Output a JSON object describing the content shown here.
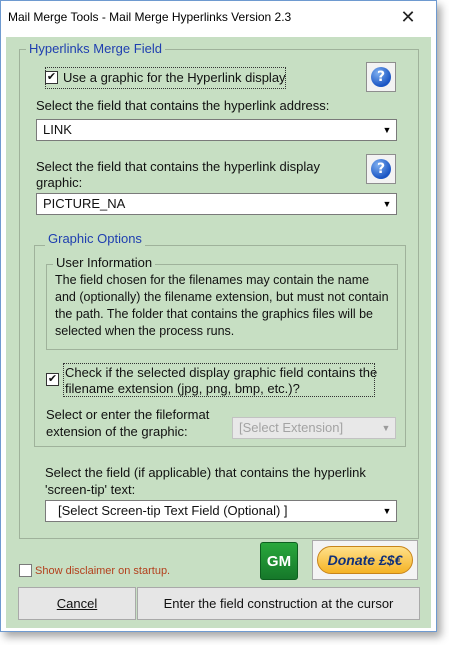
{
  "window": {
    "title": "Mail Merge Tools - Mail Merge Hyperlinks Version 2.3",
    "close_glyph": "✕"
  },
  "hyperlinks_group": {
    "legend": "Hyperlinks Merge Field",
    "use_graphic": {
      "checked": true,
      "label": "Use a graphic for the Hyperlink display"
    },
    "address_prompt": "Select the field that contains the hyperlink address:",
    "address_value": "LINK",
    "graphic_prompt_line1": "Select the field that contains the hyperlink display",
    "graphic_prompt_line2": "graphic:",
    "graphic_value": "PICTURE_NA",
    "help_glyph": "?"
  },
  "graphic_options": {
    "legend": "Graphic Options",
    "user_info": {
      "legend": "User Information",
      "text": "The field chosen for the filenames may contain the name and (optionally) the filename extension, but must not contain the path. The folder that contains the graphics files will be selected when the process runs."
    },
    "extension_check": {
      "checked": true,
      "label_line1": "Check if the selected display graphic field contains the",
      "label_line2": "filename extension (jpg, png, bmp, etc.)?"
    },
    "fileformat_prompt_line1": "Select or enter the fileformat",
    "fileformat_prompt_line2": "extension of the graphic:",
    "fileformat_value": "[Select Extension]"
  },
  "screentip": {
    "prompt_line1": "Select the field (if applicable) that contains the hyperlink",
    "prompt_line2": "'screen-tip' text:",
    "value": "[Select Screen-tip Text Field (Optional) ]"
  },
  "footer": {
    "disclaimer_label": "Show disclaimer on startup.",
    "disclaimer_checked": false,
    "gm_label": "GM",
    "donate_label": "Donate £$€",
    "cancel_label": "Cancel",
    "enter_label": "Enter the field construction at the cursor"
  },
  "colors": {
    "client_background": "#c7dfc3",
    "legend_blue": "#1f3fb0",
    "disclaimer_orange": "#b3401d",
    "gm_green": "#1f8f33",
    "donate_gold": "#f5b325"
  },
  "icons": {
    "help": "question-mark-icon",
    "dropdown": "dropdown-arrow-icon",
    "close": "close-icon",
    "check": "checkmark-icon"
  }
}
